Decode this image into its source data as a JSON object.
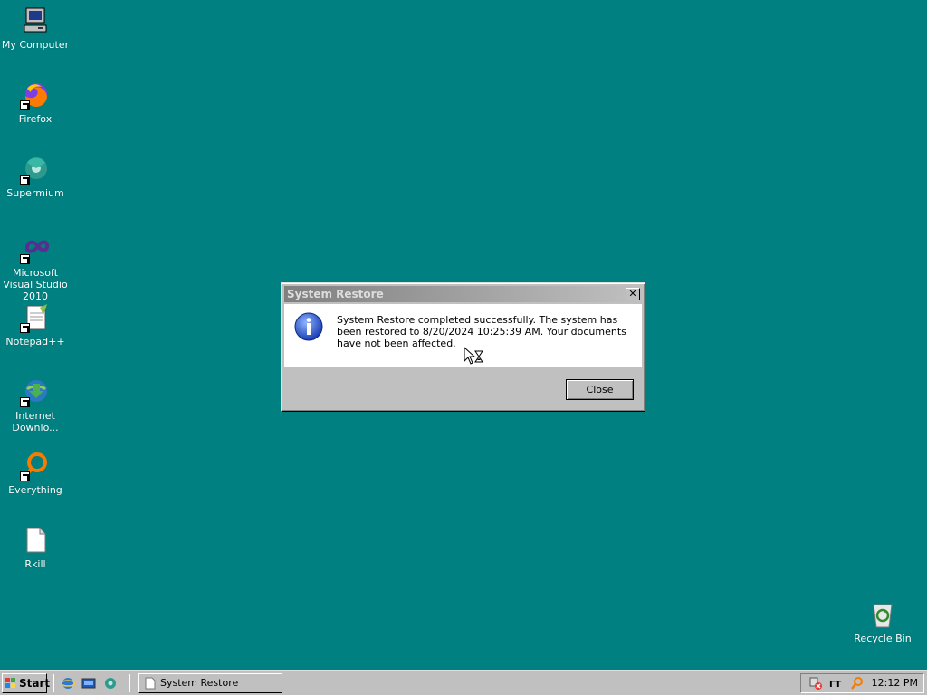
{
  "desktop": {
    "background": "#008080",
    "icons": [
      {
        "label": "My Computer",
        "icon": "computer-icon"
      },
      {
        "label": "Firefox",
        "icon": "firefox-icon"
      },
      {
        "label": "Supermium",
        "icon": "supermium-icon"
      },
      {
        "label": "Microsoft Visual Studio 2010",
        "icon": "visual-studio-icon"
      },
      {
        "label": "Notepad++",
        "icon": "notepadpp-icon"
      },
      {
        "label": "Internet Downlo...",
        "icon": "internet-download-manager-icon"
      },
      {
        "label": "Everything",
        "icon": "everything-search-icon"
      },
      {
        "label": "Rkill",
        "icon": "document-icon"
      },
      {
        "label": "Recycle Bin",
        "icon": "recycle-bin-icon"
      }
    ]
  },
  "dialog": {
    "title": "System Restore",
    "message": "System Restore completed successfully. The system has been restored to 8/20/2024 10:25:39 AM. Your documents have not been affected.",
    "close_button": "Close",
    "close_x": "✕"
  },
  "taskbar": {
    "start_label": "Start",
    "task_button": "System Restore",
    "clock": "12:12 PM",
    "quick_launch": [
      "ie-icon",
      "show-desktop-icon",
      "supermium-icon"
    ],
    "tray_icons": [
      "network-disconnected-icon",
      "keyboard-layout-icon",
      "search-icon"
    ]
  }
}
